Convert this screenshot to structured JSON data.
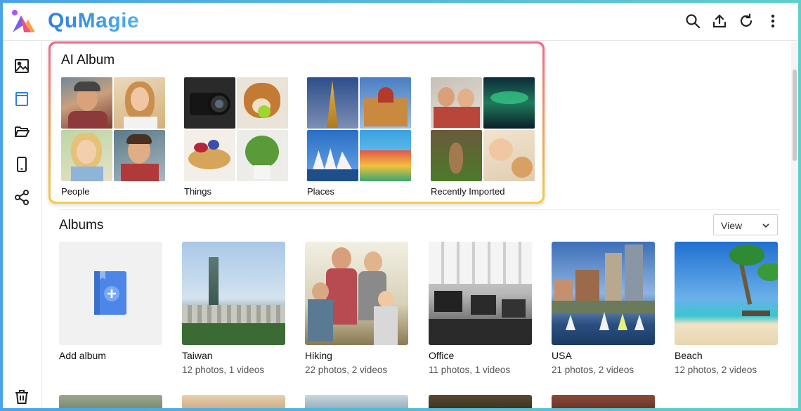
{
  "brand": {
    "name": "QuMagie"
  },
  "header": {
    "icons": [
      "search-icon",
      "upload-icon",
      "refresh-icon",
      "more-vertical-icon"
    ]
  },
  "sidebar": {
    "items": [
      "photos-icon",
      "albums-icon",
      "folders-icon",
      "mobile-icon",
      "share-icon"
    ],
    "bottom": "trash-icon"
  },
  "ai_album": {
    "title": "AI Album",
    "groups": [
      {
        "label": "People"
      },
      {
        "label": "Things"
      },
      {
        "label": "Places"
      },
      {
        "label": "Recently Imported"
      }
    ]
  },
  "albums": {
    "title": "Albums",
    "view_label": "View",
    "add_label": "Add album",
    "items": [
      {
        "name": "Taiwan",
        "count": "12 photos, 1 videos"
      },
      {
        "name": "Hiking",
        "count": "22 photos, 2 videos"
      },
      {
        "name": "Office",
        "count": "11 photos, 1 videos"
      },
      {
        "name": "USA",
        "count": "21 photos, 2 videos"
      },
      {
        "name": "Beach",
        "count": "12 photos, 2 videos"
      }
    ]
  },
  "colors": {
    "accent": "#2f7fe0",
    "card_gradient_top": "#f06a8c",
    "card_gradient_bottom": "#f2cd4a"
  }
}
